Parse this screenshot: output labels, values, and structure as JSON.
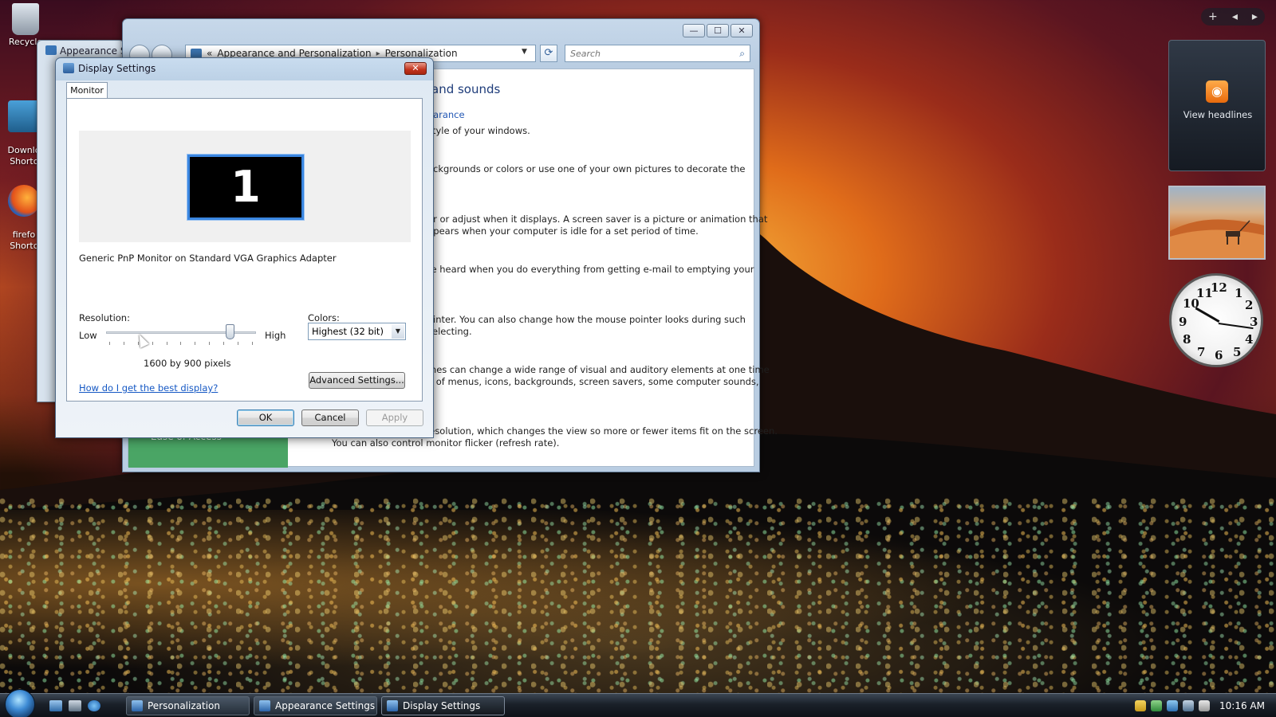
{
  "desktop": {
    "icons": [
      {
        "label": "Recycle"
      },
      {
        "label": "Downlo\nShortc"
      },
      {
        "label": "firefo\nShortc"
      }
    ]
  },
  "appearance_window": {
    "title": "Appearance Se"
  },
  "personalization": {
    "title_controls": {
      "minimize": "—",
      "maximize": "☐",
      "close": "✕"
    },
    "breadcrumb": {
      "prefix": "«",
      "item1": "Appearance and Personalization",
      "sep": "▸",
      "item2": "Personalization"
    },
    "search": {
      "placeholder": "Search"
    },
    "content": {
      "heading": "and sounds",
      "link": "earance",
      "lines": [
        "style of your windows.",
        "ackgrounds or colors or use one of your own pictures to decorate the",
        "er or adjust when it displays. A screen saver is a picture or animation that",
        "ppears when your computer is idle for a set period of time.",
        "re heard when you do everything from getting e-mail to emptying your",
        "ointer. You can also change how the mouse pointer looks during such",
        "selecting.",
        "mes can change a wide range of visual and auditory elements at one time",
        "e of menus, icons, backgrounds, screen savers, some computer sounds,",
        "Adjust your monitor resolution, which changes the view so more or fewer items fit on the screen.",
        "You can also control monitor flicker (refresh rate)."
      ],
      "ease_label": "Ease of Access"
    }
  },
  "display_settings": {
    "title": "Display Settings",
    "close": "✕",
    "tab": "Monitor",
    "monitor_number": "1",
    "monitor_desc": "Generic PnP Monitor on Standard VGA Graphics Adapter",
    "resolution_label": "Resolution:",
    "low": "Low",
    "high": "High",
    "resolution_value": "1600 by 900 pixels",
    "slider_position": 0.85,
    "colors_label": "Colors:",
    "colors_value": "Highest (32 bit)",
    "help_link": "How do I get the best display?",
    "advanced_button": "Advanced Settings...",
    "ok": "OK",
    "cancel": "Cancel",
    "apply": "Apply"
  },
  "gadgets": {
    "toolbar": {
      "add": "+",
      "prev": "◂",
      "next": "▸"
    },
    "feed_label": "View headlines",
    "feed_icon": "rss-icon",
    "clock_numbers": [
      "12",
      "1",
      "2",
      "3",
      "4",
      "5",
      "6",
      "7",
      "8",
      "9",
      "10",
      "11"
    ]
  },
  "taskbar": {
    "buttons": [
      {
        "label": "Personalization"
      },
      {
        "label": "Appearance Settings"
      },
      {
        "label": "Display Settings"
      }
    ],
    "time": "10:16 AM"
  }
}
